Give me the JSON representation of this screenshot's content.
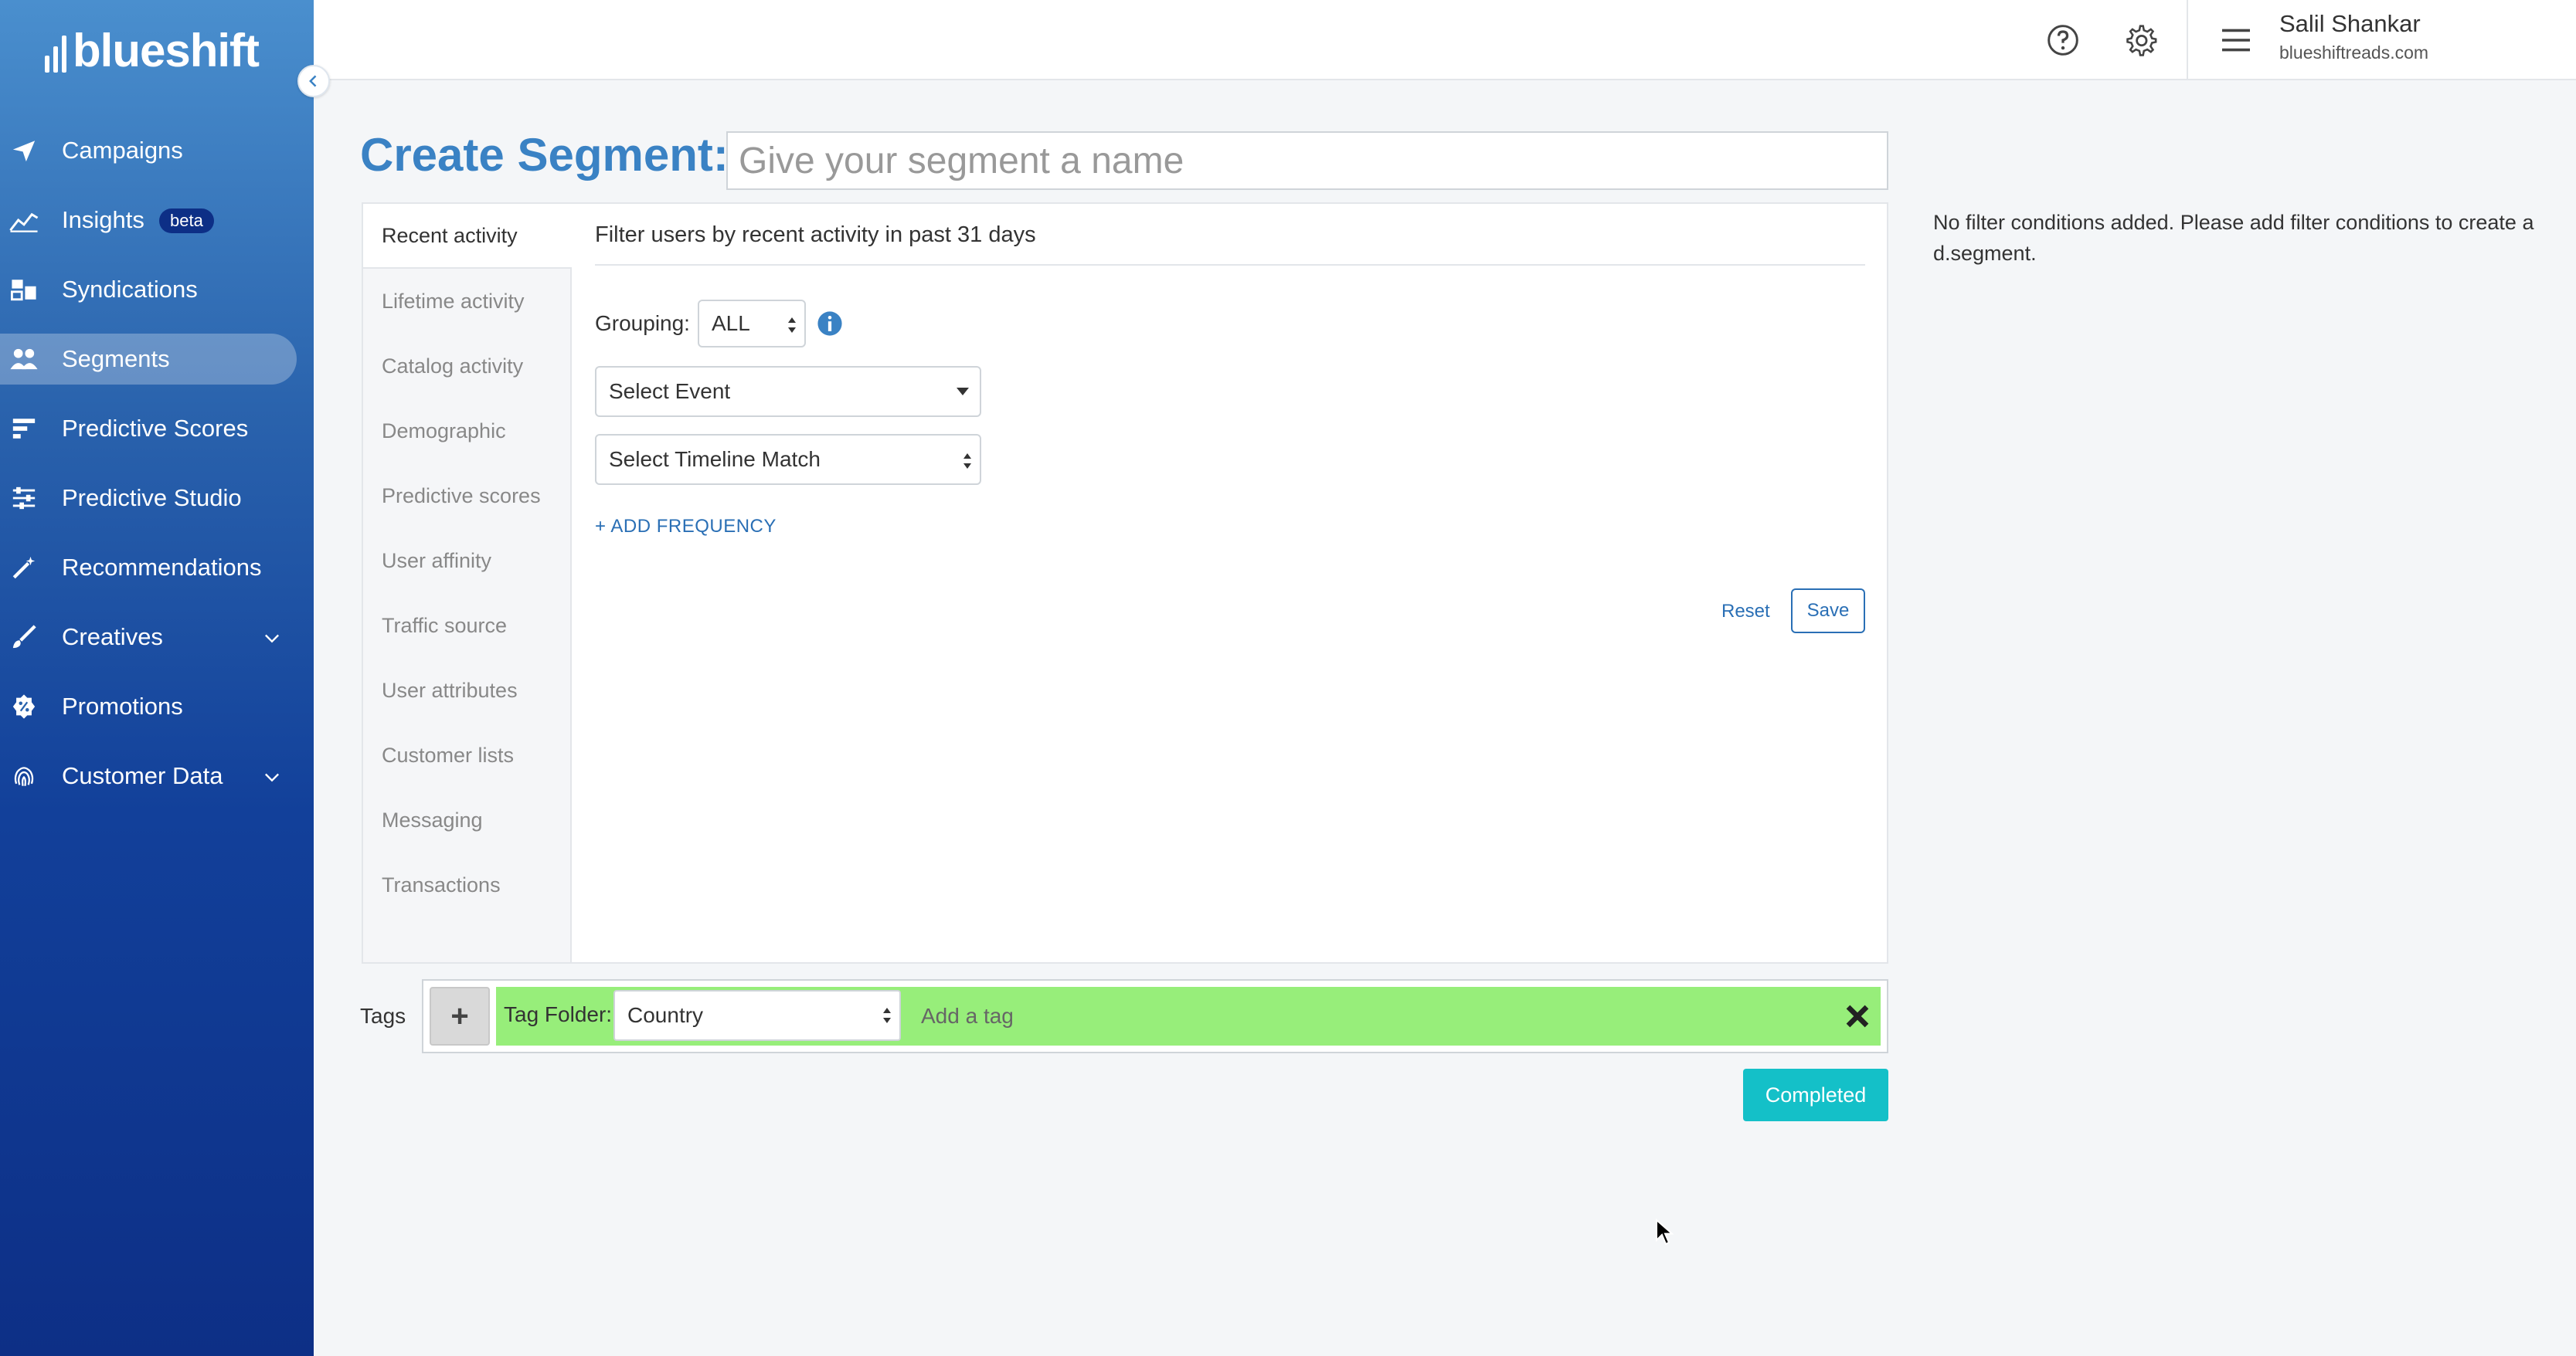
{
  "app": {
    "logo_text": "blueshift"
  },
  "sidebar": {
    "items": [
      {
        "label": "Campaigns",
        "icon": "paper-plane-icon"
      },
      {
        "label": "Insights",
        "icon": "line-chart-icon",
        "badge": "beta"
      },
      {
        "label": "Syndications",
        "icon": "syndication-icon"
      },
      {
        "label": "Segments",
        "icon": "users-icon",
        "active": true
      },
      {
        "label": "Predictive Scores",
        "icon": "bars-icon"
      },
      {
        "label": "Predictive Studio",
        "icon": "sliders-icon"
      },
      {
        "label": "Recommendations",
        "icon": "magic-wand-icon"
      },
      {
        "label": "Creatives",
        "icon": "brush-icon",
        "expandable": true
      },
      {
        "label": "Promotions",
        "icon": "badge-percent-icon"
      },
      {
        "label": "Customer Data",
        "icon": "fingerprint-icon",
        "expandable": true
      }
    ]
  },
  "header": {
    "user_name": "Salil Shankar",
    "user_domain": "blueshiftreads.com"
  },
  "main": {
    "title": "Create Segment:",
    "name_placeholder": "Give your segment a name",
    "tabs": [
      "Recent activity",
      "Lifetime activity",
      "Catalog activity",
      "Demographic",
      "Predictive scores",
      "User affinity",
      "Traffic source",
      "User attributes",
      "Customer lists",
      "Messaging",
      "Transactions"
    ],
    "filter_title": "Filter users by recent activity in past 31 days",
    "grouping_label": "Grouping:",
    "grouping_value": "ALL",
    "select_event": "Select Event",
    "select_timeline": "Select Timeline Match",
    "add_frequency": "+ ADD FREQUENCY",
    "reset": "Reset",
    "save": "Save",
    "side_note": "No filter conditions added. Please add filter conditions to create a d.segment."
  },
  "tags": {
    "label": "Tags",
    "plus": "+",
    "folder_label": "Tag Folder:",
    "folder_value": "Country",
    "input_placeholder": "Add a tag"
  },
  "completed_button": "Completed",
  "colors": {
    "accent": "#3a82c4",
    "link": "#2a6fb5",
    "tag_green": "#97ee7a",
    "completed": "#14c0c8",
    "sidebar_dark": "#0d2f86"
  }
}
